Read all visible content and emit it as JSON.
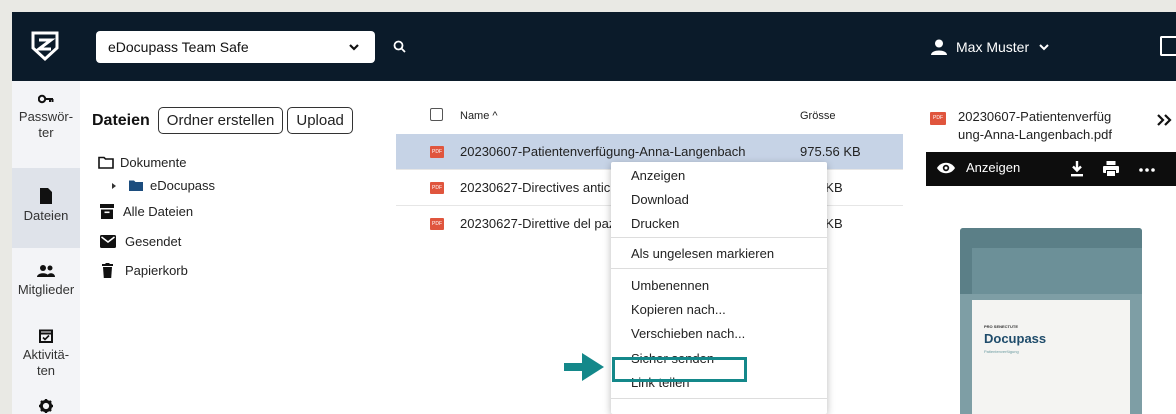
{
  "topbar": {
    "safe_select": "eDocupass Team Safe",
    "user_name": "Max Muster"
  },
  "nav": {
    "passwords": "Passwör-\nter",
    "files": "Dateien",
    "members": "Mitglieder",
    "activities": "Aktivitä-\nten"
  },
  "files": {
    "title": "Dateien",
    "create_folder": "Ordner erstellen",
    "upload": "Upload",
    "tree": {
      "documents": "Dokumente",
      "edocupass": "eDocupass",
      "all_files": "Alle Dateien",
      "sent": "Gesendet",
      "trash": "Papierkorb"
    }
  },
  "list": {
    "col_name": "Name ^",
    "col_size": "Grösse",
    "rows": [
      {
        "name": "20230607-Patientenverfügung-Anna-Langenbach",
        "size": "975.56 KB"
      },
      {
        "name": "20230627-Directives anticipées",
        "size": "889 KB"
      },
      {
        "name": "20230627-Direttive del paziente",
        "size": "901 KB"
      }
    ]
  },
  "menu": {
    "view": "Anzeigen",
    "download": "Download",
    "print": "Drucken",
    "mark_unread": "Als ungelesen markieren",
    "rename": "Umbenennen",
    "copy_to": "Kopieren nach...",
    "move_to": "Verschieben nach...",
    "send_secure": "Sicher senden",
    "share_link": "Link teilen"
  },
  "preview": {
    "title": "20230607-Patientenverfüg ung-Anna-Langenbach.pdf",
    "view": "Anzeigen",
    "doc_small": "PRO SENECTUTE",
    "doc_brand": "Docupass",
    "doc_sub": "Patientenverfügung"
  },
  "colors": {
    "topbar": "#0b1b2a",
    "selected_row": "#c6d3e6",
    "highlight": "#14888a",
    "pdf_red": "#e0553d"
  }
}
